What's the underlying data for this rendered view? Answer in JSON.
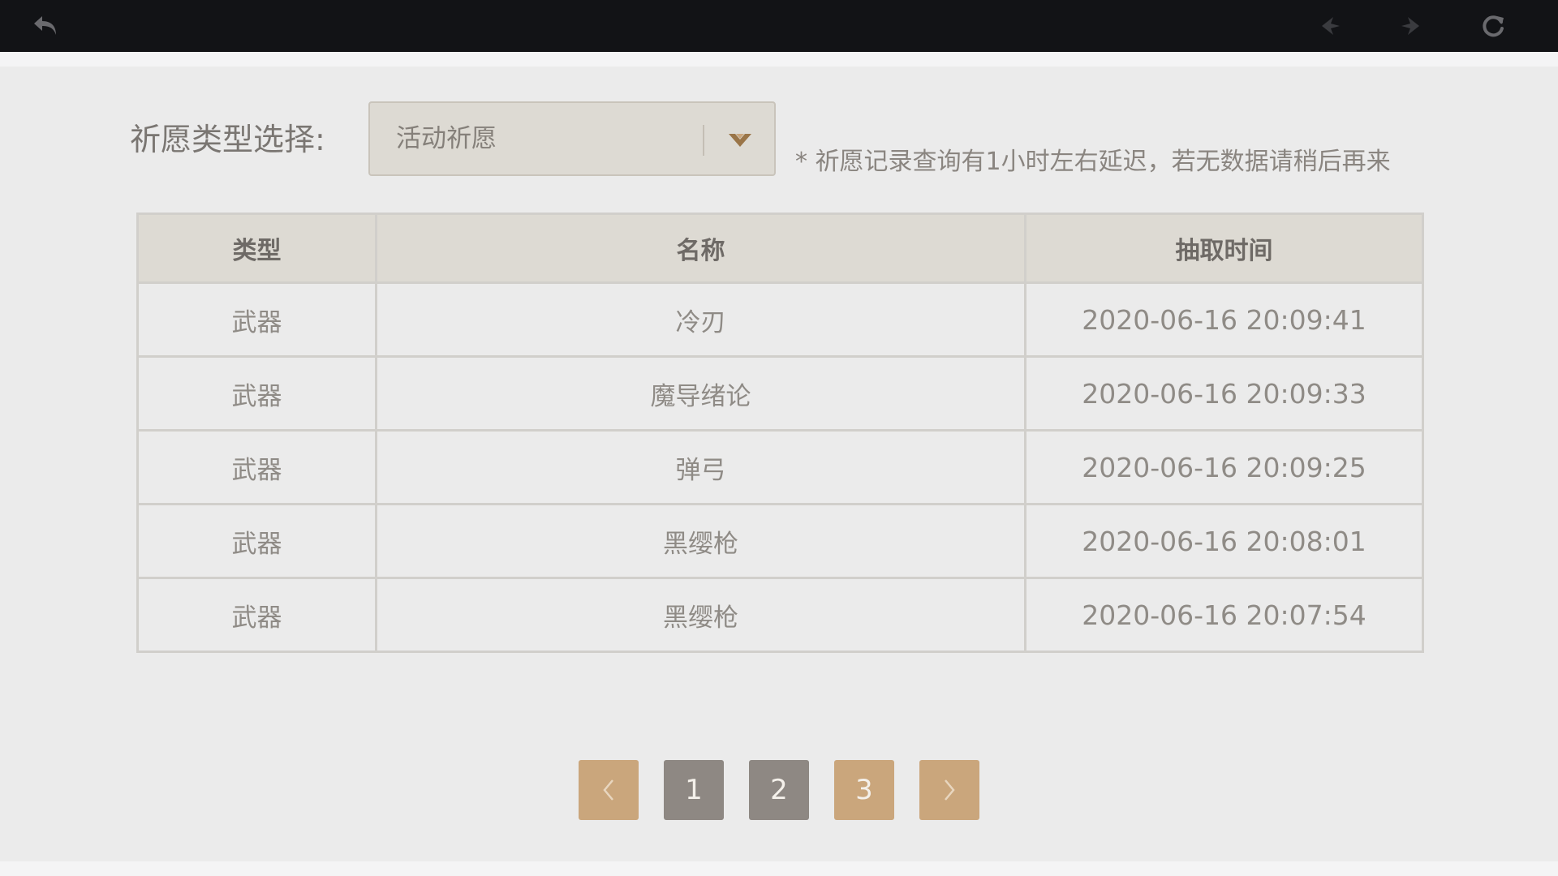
{
  "colors": {
    "topbar_bg": "#121316",
    "panel_bg": "#ebebeb",
    "header_bg": "#dddad3",
    "accent_gold": "#caa67c",
    "page_gray": "#8e8883"
  },
  "toolbar": {
    "back_icon": "back-arrow-icon",
    "prev_icon": "nav-left-icon",
    "next_icon": "nav-right-icon",
    "refresh_icon": "refresh-icon"
  },
  "filter": {
    "label": "祈愿类型选择:",
    "selected": "活动祈愿",
    "caret_icon": "chevron-down-icon"
  },
  "notice": "* 祈愿记录查询有1小时左右延迟，若无数据请稍后再来",
  "table": {
    "columns": [
      "类型",
      "名称",
      "抽取时间"
    ],
    "rows": [
      {
        "type": "武器",
        "name": "冷刃",
        "time": "2020-06-16 20:09:41"
      },
      {
        "type": "武器",
        "name": "魔导绪论",
        "time": "2020-06-16 20:09:33"
      },
      {
        "type": "武器",
        "name": "弹弓",
        "time": "2020-06-16 20:09:25"
      },
      {
        "type": "武器",
        "name": "黑缨枪",
        "time": "2020-06-16 20:08:01"
      },
      {
        "type": "武器",
        "name": "黑缨枪",
        "time": "2020-06-16 20:07:54"
      }
    ]
  },
  "pagination": {
    "pages": [
      "1",
      "2",
      "3"
    ],
    "current": "3",
    "prev_icon": "chevron-left-icon",
    "next_icon": "chevron-right-icon"
  }
}
